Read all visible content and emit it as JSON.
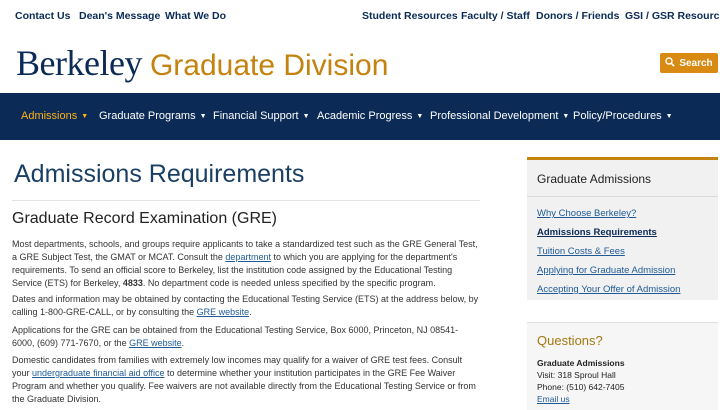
{
  "utility_nav": [
    "Contact Us",
    "Dean's Message",
    "What We Do",
    "Student Resources",
    "Faculty / Staff",
    "Donors / Friends",
    "GSI / GSR Resources"
  ],
  "brand": {
    "name": "Berkeley",
    "unit": "Graduate Division"
  },
  "search": {
    "label": "Search",
    "icon": "search-icon"
  },
  "main_nav": {
    "active": "Admissions",
    "items": [
      "Admissions",
      "Graduate Programs",
      "Financial Support",
      "Academic Progress",
      "Professional Development",
      "Policy/Procedures"
    ],
    "caret": "▼"
  },
  "page": {
    "title": "Admissions Requirements",
    "section_title": "Graduate Record Examination (GRE)",
    "p1": {
      "t1": "Most departments, schools, and groups require applicants to take a standardized test such as the GRE General Test, a GRE Subject Test, the GMAT or MCAT. Consult the ",
      "link": "department",
      "t2": " to which you are applying for the department's requirements. To send an official score to Berkeley, list the institution code assigned by the Educational Testing Service (ETS) for Berkeley, ",
      "code": "4833",
      "t3": ". No department code is needed unless specified by the specific program."
    },
    "p2": {
      "t1": "Dates and information may be obtained by contacting the Educational Testing Service (ETS) at the address below, by calling 1-800-GRE-CALL, or by consulting the ",
      "link": "GRE website",
      "t2": "."
    },
    "p3": {
      "t1": "Applications for the GRE can be obtained from the Educational Testing Service, Box 6000, Princeton, NJ 08541-6000, (609) 771-7670, or the ",
      "link": "GRE website",
      "t2": "."
    },
    "p4": {
      "t1": "Domestic candidates from families with extremely low incomes may qualify for a waiver of GRE test fees. Consult your ",
      "link": "undergraduate financial aid office",
      "t2": " to determine whether your institution participates in the GRE Fee Waiver Program and whether you qualify. Fee waivers are not available directly from the Educational Testing Service or from the Graduate Division."
    }
  },
  "sidebar": {
    "title": "Graduate Admissions",
    "current": "Admissions Requirements",
    "links": [
      "Why Choose Berkeley?",
      "Admissions Requirements",
      "Tuition Costs & Fees",
      "Applying for Graduate Admission",
      "Accepting Your Offer of Admission"
    ]
  },
  "questions": {
    "title": "Questions?",
    "office": "Graduate Admissions",
    "visit": "Visit: 318 Sproul Hall",
    "phone": "Phone: (510) 642-7405",
    "email": "Email us"
  },
  "colors": {
    "navy": "#0b2a55",
    "gold": "#c4820e",
    "search_orange": "#d98a12",
    "active_nav": "#fdb515",
    "link": "#1f5a96"
  }
}
